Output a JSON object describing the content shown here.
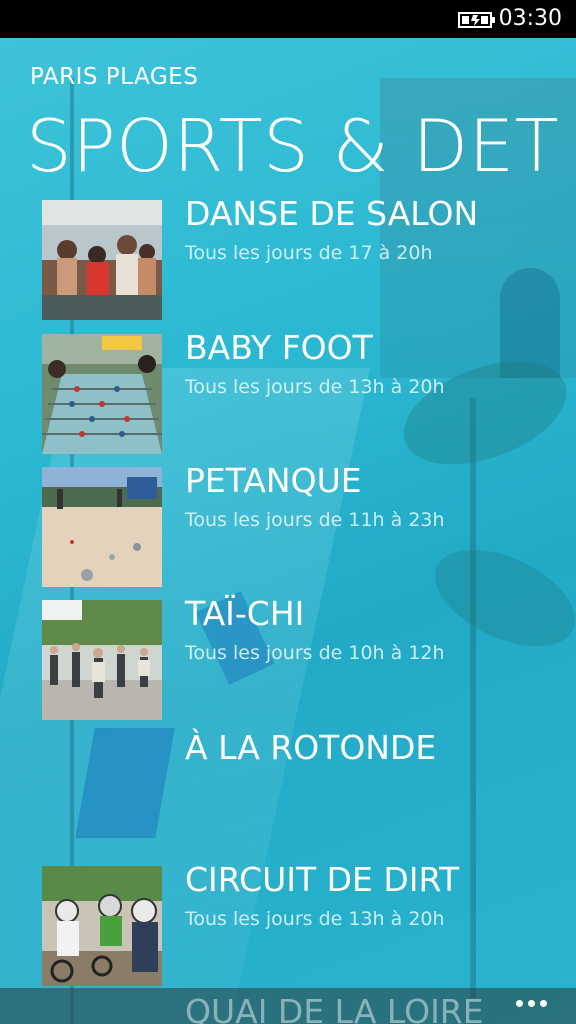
{
  "status_bar": {
    "time": "03:30",
    "battery_icon": "battery-charging-icon"
  },
  "header": {
    "app_title": "PARIS PLAGES",
    "page_title": "SPORTS & DET"
  },
  "activities": [
    {
      "title": "DANSE DE SALON",
      "schedule": "Tous les jours de 17 à 20h",
      "thumbnail": "ballroom-dance-photo"
    },
    {
      "title": "BABY FOOT",
      "schedule": "Tous les jours de 13h à 20h",
      "thumbnail": "table-football-photo"
    },
    {
      "title": "PETANQUE",
      "schedule": "Tous les jours de 11h à 23h",
      "thumbnail": "petanque-photo"
    },
    {
      "title": "TAÏ-CHI",
      "schedule": "Tous les jours de 10h à 12h",
      "thumbnail": "tai-chi-photo"
    },
    {
      "title": "À LA ROTONDE",
      "schedule": "",
      "thumbnail": ""
    },
    {
      "title": "CIRCUIT DE DIRT",
      "schedule": "Tous les jours de 13h à 20h",
      "thumbnail": "dirt-bike-photo"
    },
    {
      "title": "QUAI DE LA LOIRE",
      "schedule": "",
      "thumbnail": ""
    }
  ],
  "app_bar": {
    "more_icon": "more-ellipsis-icon"
  },
  "colors": {
    "accent": "#2bb8d2",
    "text": "#ffffff"
  }
}
